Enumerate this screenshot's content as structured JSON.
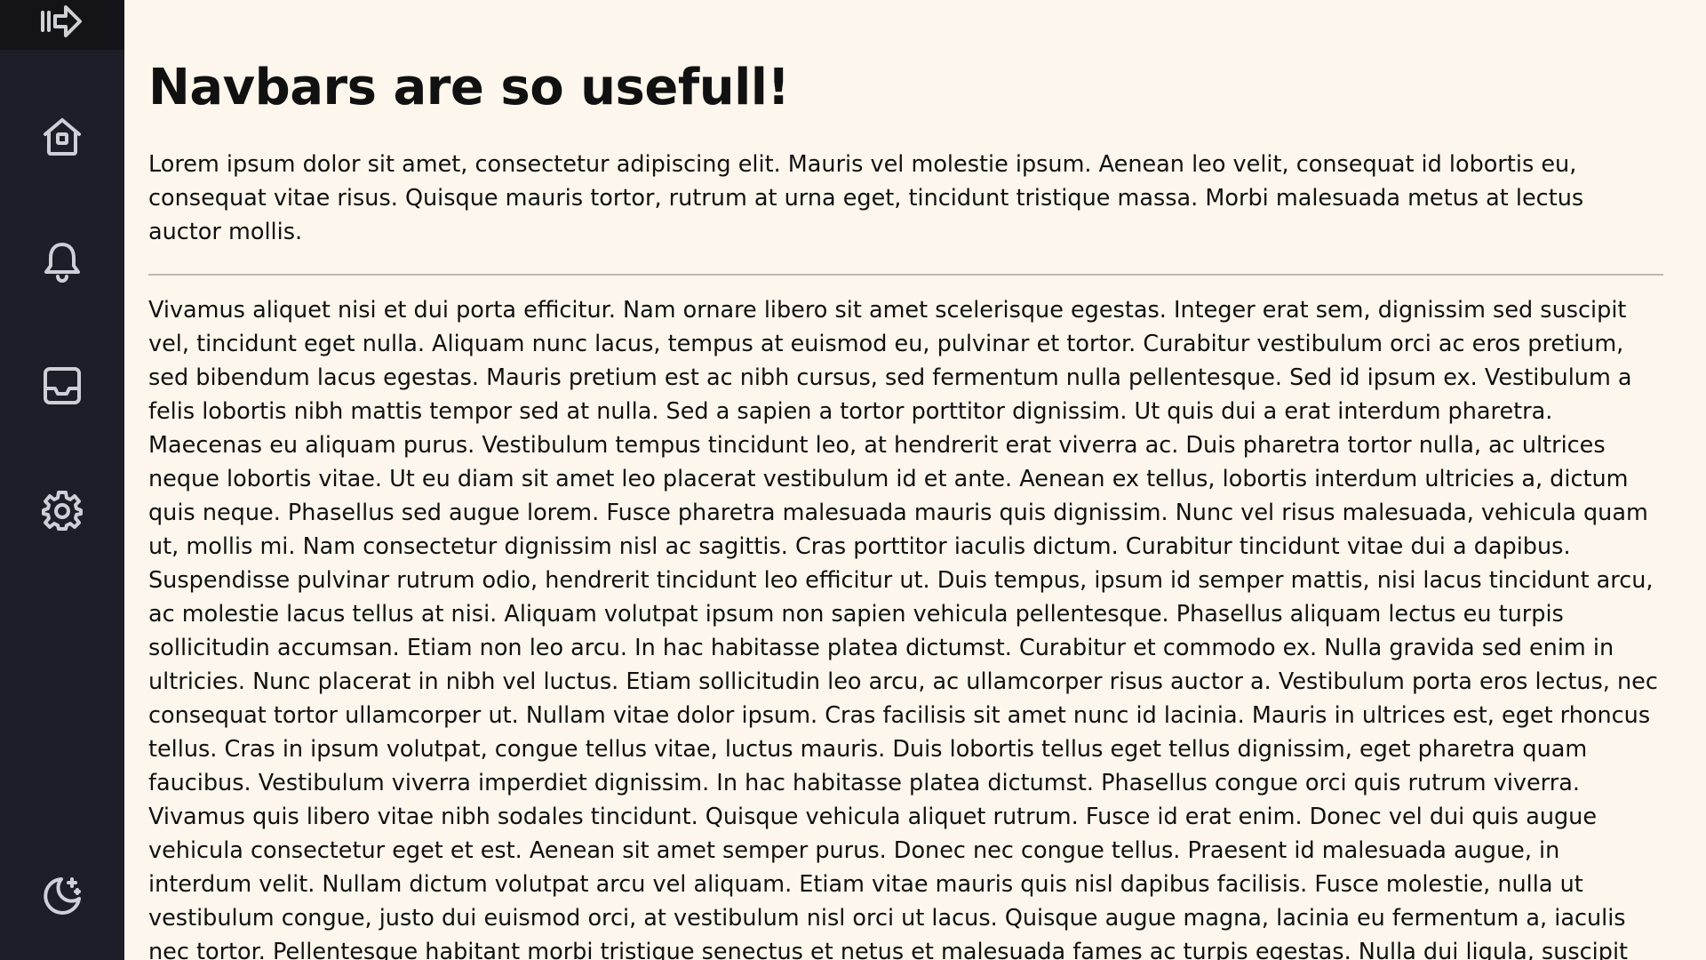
{
  "sidebar": {
    "toggle_icon": "sidebar-toggle-icon",
    "items": [
      {
        "icon": "home-icon"
      },
      {
        "icon": "bell-icon"
      },
      {
        "icon": "inbox-icon"
      },
      {
        "icon": "gear-icon"
      }
    ],
    "theme_icon": "moon-stars-icon"
  },
  "main": {
    "title": "Navbars are so usefull!",
    "paragraphs": [
      "Lorem ipsum dolor sit amet, consectetur adipiscing elit. Mauris vel molestie ipsum. Aenean leo velit, consequat id lobortis eu, consequat vitae risus. Quisque mauris tortor, rutrum at urna eget, tincidunt tristique massa. Morbi malesuada metus at lectus auctor mollis.",
      "Vivamus aliquet nisi et dui porta efficitur. Nam ornare libero sit amet scelerisque egestas. Integer erat sem, dignissim sed suscipit vel, tincidunt eget nulla. Aliquam nunc lacus, tempus at euismod eu, pulvinar et tortor. Curabitur vestibulum orci ac eros pretium, sed bibendum lacus egestas. Mauris pretium est ac nibh cursus, sed fermentum nulla pellentesque. Sed id ipsum ex. Vestibulum a felis lobortis nibh mattis tempor sed at nulla. Sed a sapien a tortor porttitor dignissim. Ut quis dui a erat interdum pharetra. Maecenas eu aliquam purus. Vestibulum tempus tincidunt leo, at hendrerit erat viverra ac. Duis pharetra tortor nulla, ac ultrices neque lobortis vitae. Ut eu diam sit amet leo placerat vestibulum id et ante. Aenean ex tellus, lobortis interdum ultricies a, dictum quis neque. Phasellus sed augue lorem. Fusce pharetra malesuada mauris quis dignissim. Nunc vel risus malesuada, vehicula quam ut, mollis mi. Nam consectetur dignissim nisl ac sagittis. Cras porttitor iaculis dictum. Curabitur tincidunt vitae dui a dapibus. Suspendisse pulvinar rutrum odio, hendrerit tincidunt leo efficitur ut. Duis tempus, ipsum id semper mattis, nisi lacus tincidunt arcu, ac molestie lacus tellus at nisi. Aliquam volutpat ipsum non sapien vehicula pellentesque. Phasellus aliquam lectus eu turpis sollicitudin accumsan. Etiam non leo arcu. In hac habitasse platea dictumst. Curabitur et commodo ex. Nulla gravida sed enim in ultricies. Nunc placerat in nibh vel luctus. Etiam sollicitudin leo arcu, ac ullamcorper risus auctor a. Vestibulum porta eros lectus, nec consequat tortor ullamcorper ut. Nullam vitae dolor ipsum. Cras facilisis sit amet nunc id lacinia. Mauris in ultrices est, eget rhoncus tellus. Cras in ipsum volutpat, congue tellus vitae, luctus mauris. Duis lobortis tellus eget tellus dignissim, eget pharetra quam faucibus. Vestibulum viverra imperdiet dignissim. In hac habitasse platea dictumst. Phasellus congue orci quis rutrum viverra. Vivamus quis libero vitae nibh sodales tincidunt. Quisque vehicula aliquet rutrum. Fusce id erat enim. Donec vel dui quis augue vehicula consectetur eget et est. Aenean sit amet semper purus. Donec nec congue tellus. Praesent id malesuada augue, in interdum velit. Nullam dictum volutpat arcu vel aliquam. Etiam vitae mauris quis nisl dapibus facilisis. Fusce molestie, nulla ut vestibulum congue, justo dui euismod orci, at vestibulum nisl orci ut lacus. Quisque augue magna, lacinia eu fermentum a, iaculis nec tortor. Pellentesque habitant morbi tristique senectus et netus et malesuada fames ac turpis egestas. Nulla dui ligula, suscipit"
    ]
  },
  "colors": {
    "sidebar_bg": "#1e1e29",
    "sidebar_top_bg": "#131318",
    "icon_color": "#cfcfd6",
    "page_bg": "#fdf6ec",
    "text": "#111111",
    "divider": "#bdb8b0"
  }
}
